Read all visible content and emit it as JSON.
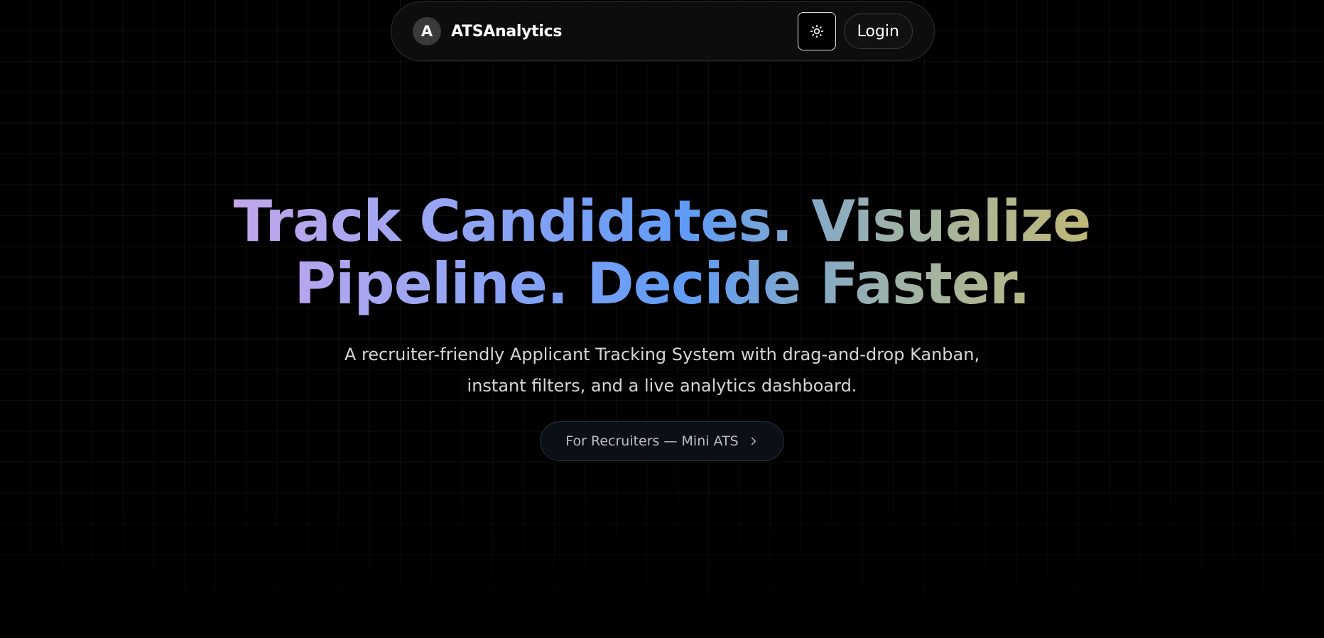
{
  "navbar": {
    "brand_initial": "A",
    "brand_name": "ATSAnalytics",
    "theme_toggle_icon": "sun-icon",
    "login_label": "Login"
  },
  "hero": {
    "headline_line1": "Track Candidates. Visualize",
    "headline_line2": "Pipeline. Decide Faster.",
    "subtitle_line1": "A recruiter-friendly Applicant Tracking System with drag-and-drop Kanban,",
    "subtitle_line2": "instant filters, and a live analytics dashboard.",
    "cta_label": "For Recruiters — Mini ATS",
    "cta_icon": "chevron-right-icon"
  },
  "colors": {
    "background": "#000000",
    "gradient": [
      "#f2a3d8",
      "#a7a7f2",
      "#5f9cf7",
      "#9fb3a7",
      "#e8be3c"
    ]
  }
}
